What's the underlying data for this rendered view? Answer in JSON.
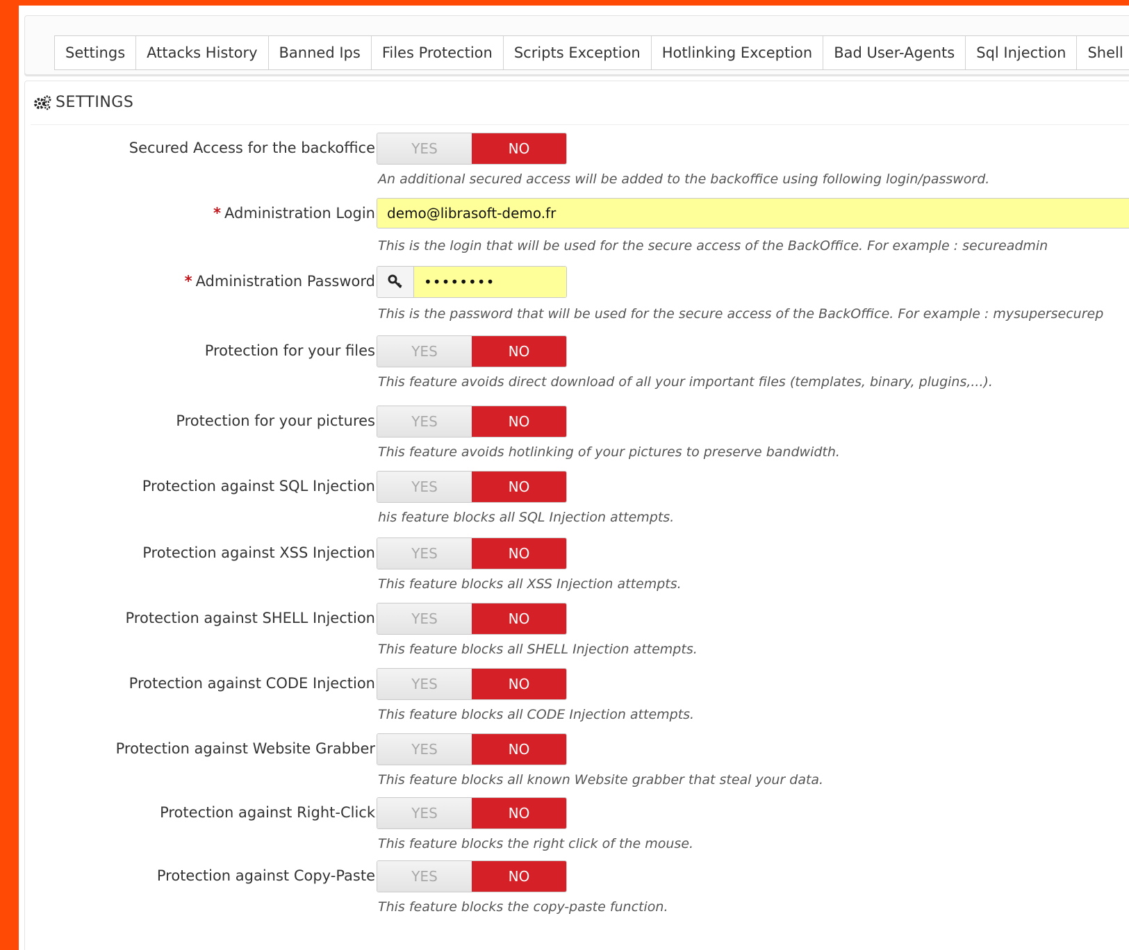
{
  "tabs": [
    "Settings",
    "Attacks History",
    "Banned Ips",
    "Files Protection",
    "Scripts Exception",
    "Hotlinking Exception",
    "Bad User-Agents",
    "Sql Injection",
    "Shell Injection"
  ],
  "panel": {
    "title": "SETTINGS"
  },
  "switch_labels": {
    "yes": "YES",
    "no": "NO"
  },
  "colors": {
    "accent_no": "#d52027",
    "input_highlight": "#ffff9a",
    "page_border": "#ff4a05"
  },
  "fields": {
    "secured_access": {
      "label": "Secured Access for the backoffice",
      "value": "NO",
      "help": "An additional secured access will be added to the backoffice using following login/password."
    },
    "admin_login": {
      "required_mark": "*",
      "label": "Administration Login",
      "value": "demo@librasoft-demo.fr",
      "help": "This is the login that will be used for the secure access of the BackOffice. For example : secureadmin"
    },
    "admin_password": {
      "required_mark": "*",
      "label": "Administration Password",
      "value": "••••••••",
      "icon": "key-icon",
      "help": "This is the password that will be used for the secure access of the BackOffice. For example : mysupersecurep"
    },
    "toggles": [
      {
        "label": "Protection for your files",
        "value": "NO",
        "help": "This feature avoids direct download of all your important files (templates, binary, plugins,...)."
      },
      {
        "label": "Protection for your pictures",
        "value": "NO",
        "help": "This feature avoids hotlinking of your pictures to preserve bandwidth."
      },
      {
        "label": "Protection against SQL Injection",
        "value": "NO",
        "help": "his feature blocks all SQL Injection attempts."
      },
      {
        "label": "Protection against XSS Injection",
        "value": "NO",
        "help": "This feature blocks all XSS Injection attempts."
      },
      {
        "label": "Protection against SHELL Injection",
        "value": "NO",
        "help": "This feature blocks all SHELL Injection attempts."
      },
      {
        "label": "Protection against CODE Injection",
        "value": "NO",
        "help": "This feature blocks all CODE Injection attempts."
      },
      {
        "label": "Protection against Website Grabber",
        "value": "NO",
        "help": "This feature blocks all known Website grabber that steal your data."
      },
      {
        "label": "Protection against Right-Click",
        "value": "NO",
        "help": "This feature blocks the right click of the mouse."
      },
      {
        "label": "Protection against Copy-Paste",
        "value": "NO",
        "help": "This feature blocks the copy-paste function."
      }
    ]
  }
}
